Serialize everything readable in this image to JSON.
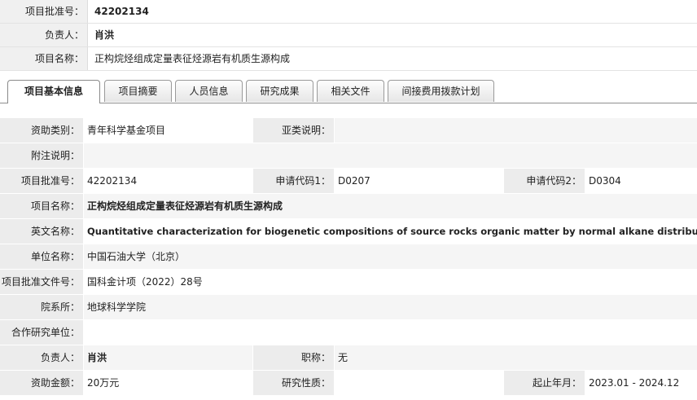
{
  "summary": {
    "approval_no_label": "项目批准号：",
    "approval_no": "42202134",
    "leader_label": "负责人：",
    "leader": "肖洪",
    "project_name_label": "项目名称：",
    "project_name": "正构烷烃组成定量表征烃源岩有机质生源构成"
  },
  "tabs": [
    {
      "label": "项目基本信息",
      "active": true
    },
    {
      "label": "项目摘要"
    },
    {
      "label": "人员信息"
    },
    {
      "label": "研究成果"
    },
    {
      "label": "相关文件"
    },
    {
      "label": "间接费用拨款计划"
    }
  ],
  "detail": {
    "funding_type_label": "资助类别：",
    "funding_type": "青年科学基金项目",
    "subtype_label": "亚类说明：",
    "subtype": "",
    "note_label": "附注说明：",
    "note": "",
    "approval_no_label": "项目批准号：",
    "approval_no": "42202134",
    "apply_code1_label": "申请代码1：",
    "apply_code1": "D0207",
    "apply_code2_label": "申请代码2：",
    "apply_code2": "D0304",
    "project_name_label": "项目名称：",
    "project_name": "正构烷烃组成定量表征烃源岩有机质生源构成",
    "english_name_label": "英文名称：",
    "english_name": "Quantitative characterization for biogenetic compositions of source rocks organic matter by normal alkane distributions",
    "unit_label": "单位名称：",
    "unit": "中国石油大学（北京）",
    "approval_doc_label": "项目批准文件号：",
    "approval_doc": "国科金计项（2022）28号",
    "department_label": "院系所：",
    "department": "地球科学学院",
    "coop_unit_label": "合作研究单位：",
    "coop_unit": "",
    "leader_label": "负责人：",
    "leader": "肖洪",
    "title_label": "职称：",
    "title": "无",
    "amount_label": "资助金额：",
    "amount": "20万元",
    "nature_label": "研究性质：",
    "nature": "",
    "period_label": "起止年月：",
    "period": "2023.01 - 2024.12"
  }
}
